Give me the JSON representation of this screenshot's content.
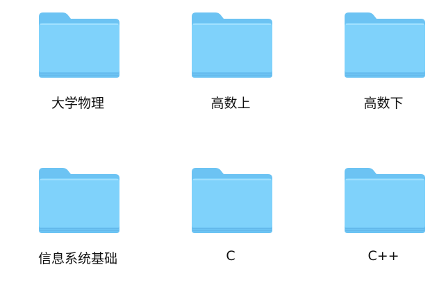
{
  "folders": [
    {
      "label": "大学物理",
      "icon": "folder-icon"
    },
    {
      "label": "高数上",
      "icon": "folder-icon"
    },
    {
      "label": "高数下",
      "icon": "folder-icon"
    },
    {
      "label": "信息系统基础",
      "icon": "folder-icon"
    },
    {
      "label": "C",
      "icon": "folder-icon"
    },
    {
      "label": "C++",
      "icon": "folder-icon"
    }
  ],
  "colors": {
    "folder_back": "#6cc3f3",
    "folder_front": "#7fd2fb",
    "folder_edge": "#5fb3e6"
  }
}
